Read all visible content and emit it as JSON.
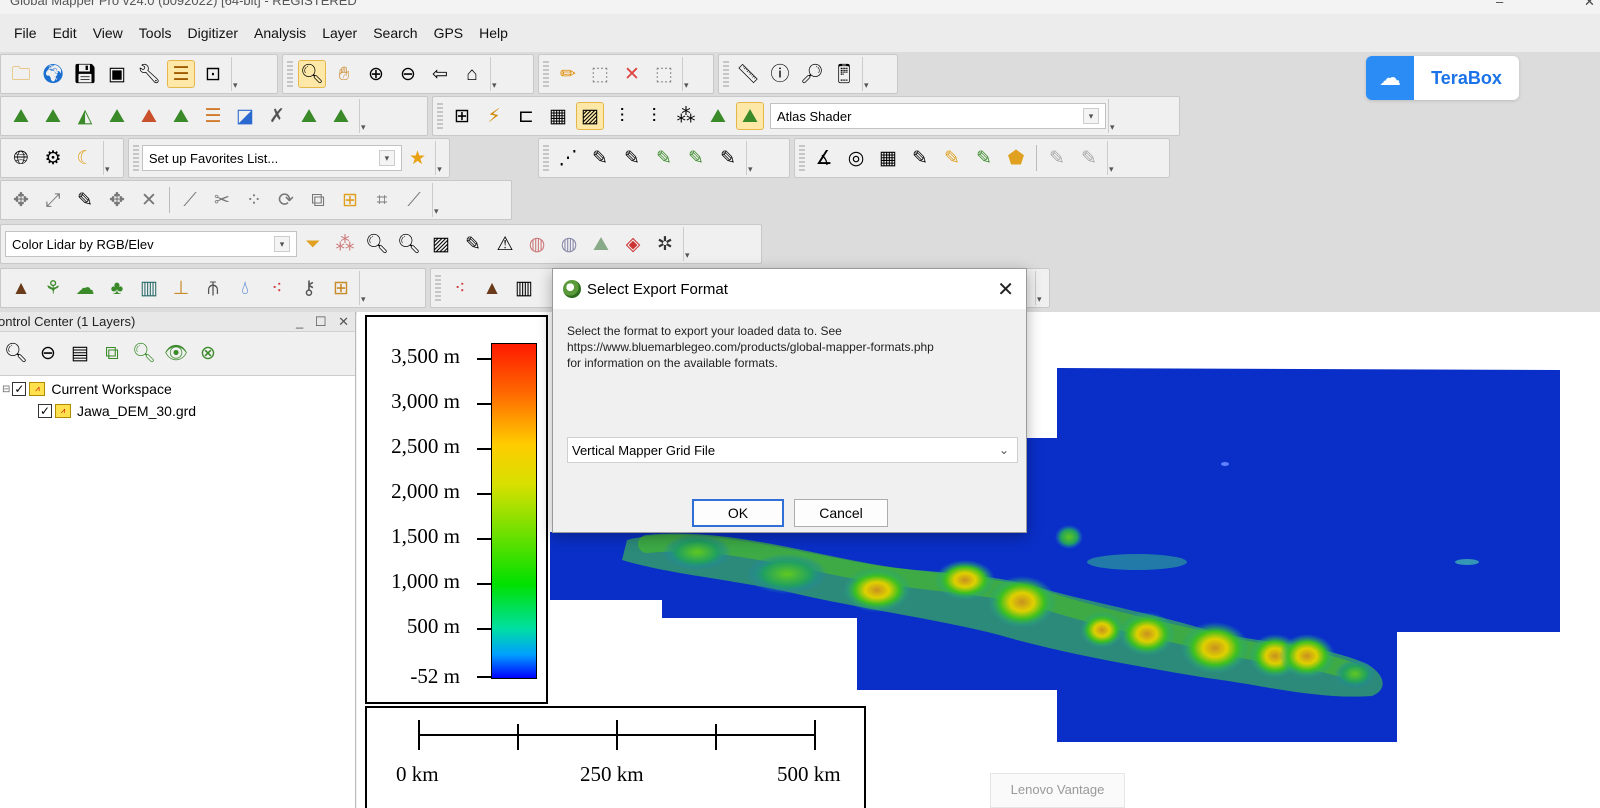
{
  "window": {
    "title": "Global Mapper Pro v24.0 (b092022) [64-bit] - REGISTERED",
    "minimize": "–",
    "close": "✕"
  },
  "menu": [
    "File",
    "Edit",
    "View",
    "Tools",
    "Digitizer",
    "Analysis",
    "Layer",
    "Search",
    "GPS",
    "Help"
  ],
  "toolbars": {
    "shader_combo": "Atlas Shader",
    "favorites_combo": "Set up Favorites List...",
    "lidar_combo": "Color Lidar by RGB/Elev"
  },
  "control_center": {
    "title": "ontrol Center (1 Layers)",
    "buttons": [
      "_",
      "☐",
      "✕"
    ],
    "workspace_label": "Current Workspace",
    "layer_label": "Jawa_DEM_30.grd"
  },
  "legend": {
    "labels": [
      "3,500 m",
      "3,000 m",
      "2,500 m",
      "2,000 m",
      "1,500 m",
      "1,000 m",
      "500 m",
      "-52 m"
    ]
  },
  "scale_bar": {
    "labels": [
      "0 km",
      "250 km",
      "500 km"
    ]
  },
  "terabox": {
    "label": "TeraBox"
  },
  "watermark": {
    "label": "Lenovo Vantage"
  },
  "dialog": {
    "title": "Select Export Format",
    "message_line1": "Select the format to export your loaded data to. See",
    "message_line2": "https://www.bluemarblegeo.com/products/global-mapper-formats.php",
    "message_line3": "for information on the available formats.",
    "selected_format": "Vertical Mapper Grid File",
    "ok_label": "OK",
    "cancel_label": "Cancel"
  },
  "colors": {
    "map_water": "#0a2fc8",
    "dialog_bg": "#f0f0f0",
    "accent": "#2f6fd6"
  }
}
